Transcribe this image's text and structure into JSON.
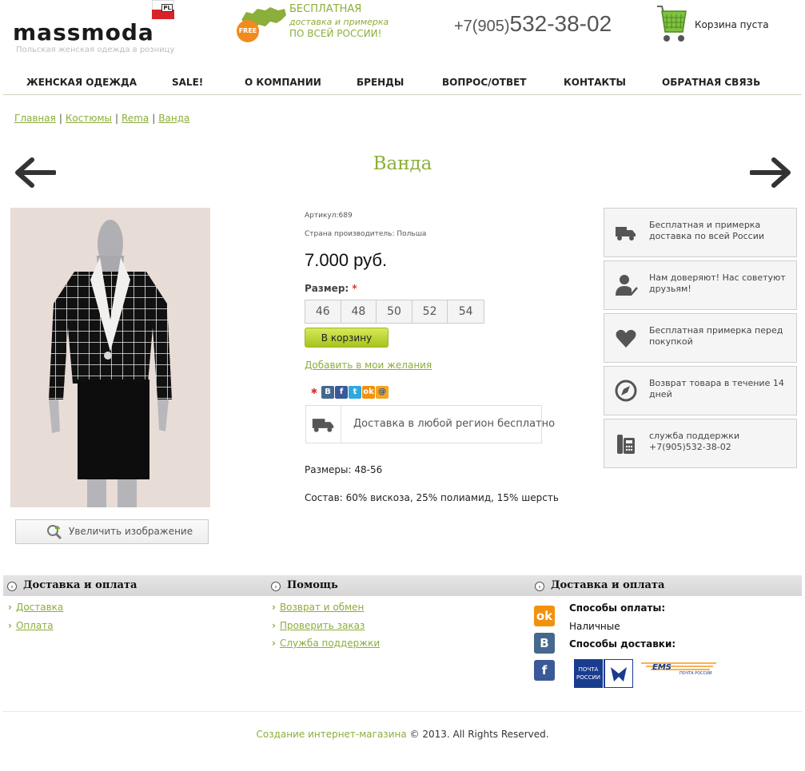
{
  "header": {
    "logo_text": "massmoda",
    "logo_badge": "PL",
    "tagline": "Польская женская одежда в розницу",
    "promo": {
      "badge": "FREE",
      "line1": "БЕСПЛАТНАЯ",
      "line2": "доставка и примерка",
      "line3": "ПО ВСЕЙ РОССИИ!"
    },
    "phone_prefix": "+7(905)",
    "phone_number": "532-38-02",
    "cart_status": "Корзина пуста"
  },
  "nav": {
    "items": [
      "ЖЕНСКАЯ ОДЕЖДА",
      "SALE!",
      "О КОМПАНИИ",
      "БРЕНДЫ",
      "ВОПРОС/ОТВЕТ",
      "КОНТАКТЫ",
      "ОБРАТНАЯ СВЯЗЬ"
    ]
  },
  "breadcrumb": {
    "items": [
      "Главная",
      "Костюмы",
      "Rema",
      "Ванда"
    ],
    "separator": "|"
  },
  "product": {
    "title": "Ванда",
    "article": "Артикул:689",
    "country": "Страна производитель: Польша",
    "price": "7.000 руб.",
    "size_label": "Размер:",
    "required_mark": "*",
    "sizes": [
      "46",
      "48",
      "50",
      "52",
      "54"
    ],
    "add_to_cart": "В корзину",
    "wishlist": "Добавить в мои желания",
    "delivery_note": "Доставка в любой регион бесплатно",
    "sizes_spec": "Размеры: 48-56",
    "composition": "Состав: 60% вискоза, 25% полиамид, 15% шерсть",
    "zoom_label": "Увеличить изображение"
  },
  "share": {
    "icons": [
      {
        "name": "moi-mir-icon",
        "glyph": "✱",
        "color": "#ffffff",
        "fg": "#e4312b"
      },
      {
        "name": "vkontakte-icon",
        "glyph": "B",
        "color": "#45688e",
        "fg": "#ffffff"
      },
      {
        "name": "facebook-icon",
        "glyph": "f",
        "color": "#3b5998",
        "fg": "#ffffff"
      },
      {
        "name": "twitter-icon",
        "glyph": "t",
        "color": "#2fa8e0",
        "fg": "#ffffff"
      },
      {
        "name": "odnoklassniki-icon",
        "glyph": "ok",
        "color": "#f2910f",
        "fg": "#ffffff"
      },
      {
        "name": "mailru-icon",
        "glyph": "@",
        "color": "#f5a623",
        "fg": "#1a4ea3"
      }
    ]
  },
  "features": [
    {
      "icon": "truck-icon",
      "text": "Бесплатная и примерка доставка по всей России"
    },
    {
      "icon": "user-check-icon",
      "text": "Нам доверяют! Нас советуют друзьям!"
    },
    {
      "icon": "heart-icon",
      "text": "Бесплатная примерка перед покупкой"
    },
    {
      "icon": "compass-icon",
      "text": "Возврат товара в течение 14 дней"
    },
    {
      "icon": "phone-icon",
      "text": "служба поддержки +7(905)532-38-02"
    }
  ],
  "footer": {
    "col1": {
      "title": "Доставка и оплата",
      "links": [
        "Доставка",
        "Оплата"
      ]
    },
    "col2": {
      "title": "Помощь",
      "links": [
        "Возврат и обмен",
        "Проверить заказ",
        "Служба поддержки"
      ]
    },
    "col3": {
      "title": "Доставка и оплата",
      "payment_title": "Способы оплаты:",
      "payment_value": "Наличные",
      "delivery_title": "Способы доставки:",
      "pochta_line1": "ПОЧТА",
      "pochta_line2": "РОССИИ",
      "ems_text": "EMS",
      "ems_sub": "ПОЧТА РОССИИ"
    },
    "copyright_link": "Создание интернет-магазина",
    "copyright_rest": " © 2013. All Rights Reserved."
  },
  "colors": {
    "accent": "#8cae3a",
    "button": "#b8d12e",
    "social_ok": "#f2910f",
    "social_vk": "#45688e",
    "social_fb": "#3b5998"
  }
}
